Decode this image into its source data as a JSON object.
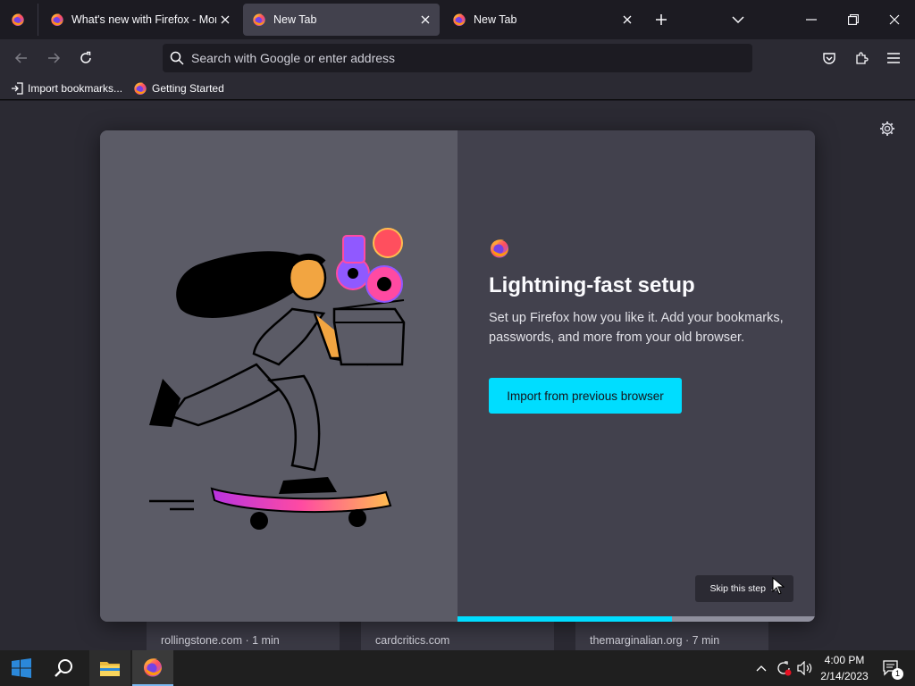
{
  "tabs": [
    {
      "title": "What's new with Firefox - More",
      "selected": false
    },
    {
      "title": "New Tab",
      "selected": true
    },
    {
      "title": "New Tab",
      "selected": false
    }
  ],
  "urlbar": {
    "placeholder": "Search with Google or enter address"
  },
  "bookmarks": [
    {
      "label": "Import bookmarks...",
      "icon": "import-icon"
    },
    {
      "label": "Getting Started",
      "icon": "firefox-icon"
    }
  ],
  "onboarding": {
    "title": "Lightning-fast setup",
    "description": "Set up Firefox how you like it. Add your bookmarks, passwords, and more from your old browser.",
    "primary_button": "Import from previous browser",
    "skip_button": "Skip this step",
    "progress": 0.6
  },
  "top_sites": [
    {
      "label": "rollingstone.com · 1 min"
    },
    {
      "label": "cardcritics.com"
    },
    {
      "label": "themarginalian.org · 7 min"
    }
  ],
  "taskbar": {
    "time": "4:00 PM",
    "date": "2/14/2023",
    "notification_count": "1"
  },
  "colors": {
    "accent": "#00ddff",
    "tab_selected": "#42414d",
    "toolbar": "#2b2a33",
    "frame": "#1c1b22"
  }
}
